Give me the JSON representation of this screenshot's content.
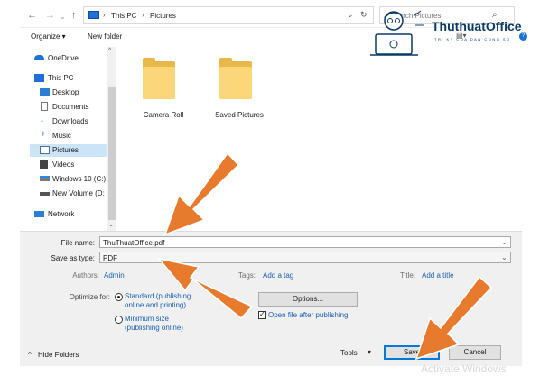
{
  "address_bar": {
    "back_icon": "arrow-left",
    "forward_icon": "arrow-right",
    "up_icon": "arrow-up",
    "breadcrumb": [
      "This PC",
      "Pictures"
    ],
    "search_placeholder": "Search Pictures"
  },
  "toolbar": {
    "organize_label": "Organize ▾",
    "new_folder_label": "New folder"
  },
  "sidebar": {
    "items": [
      {
        "label": "OneDrive",
        "icon": "cloud-icon"
      },
      {
        "label": "This PC",
        "icon": "computer-icon"
      },
      {
        "label": "Desktop",
        "icon": "desktop-icon"
      },
      {
        "label": "Documents",
        "icon": "documents-icon"
      },
      {
        "label": "Downloads",
        "icon": "download-icon"
      },
      {
        "label": "Music",
        "icon": "music-icon"
      },
      {
        "label": "Pictures",
        "icon": "pictures-icon"
      },
      {
        "label": "Videos",
        "icon": "videos-icon"
      },
      {
        "label": "Windows 10 (C:)",
        "icon": "drive-icon"
      },
      {
        "label": "New Volume (D:",
        "icon": "drive-icon"
      },
      {
        "label": "Network",
        "icon": "network-icon"
      }
    ],
    "selected": "Pictures"
  },
  "files": [
    {
      "label": "Camera Roll",
      "icon": "folder-icon"
    },
    {
      "label": "Saved Pictures",
      "icon": "folder-icon"
    }
  ],
  "form": {
    "file_name_label": "File name:",
    "file_name_value": "ThuThuatOffice.pdf",
    "save_type_label": "Save as type:",
    "save_type_value": "PDF",
    "authors_label": "Authors:",
    "authors_value": "Admin",
    "tags_label": "Tags:",
    "tags_value": "Add a tag",
    "title_label": "Title:",
    "title_value": "Add a title",
    "optimize_label": "Optimize for:",
    "optimize_standard_line1": "Standard (publishing",
    "optimize_standard_line2": "online and printing)",
    "optimize_minimum_line1": "Minimum size",
    "optimize_minimum_line2": "(publishing online)",
    "optimize_selected": "standard",
    "options_button": "Options...",
    "open_after_label": "Open file after publishing",
    "open_after_checked": true
  },
  "footer": {
    "hide_folders_label": "Hide Folders",
    "tools_label": "Tools",
    "save_button": "Save",
    "cancel_button": "Cancel",
    "watermark": "Activate Windows"
  },
  "logo": {
    "name": "ThuthuatOffice",
    "tagline": "TRI KY CUA DAN CONG SO"
  },
  "colors": {
    "accent": "#0078d7",
    "link": "#1a5fb4",
    "arrow": "#e87a2d",
    "selected_row": "#cce4f7",
    "panel_bg": "#f0f0f0"
  }
}
